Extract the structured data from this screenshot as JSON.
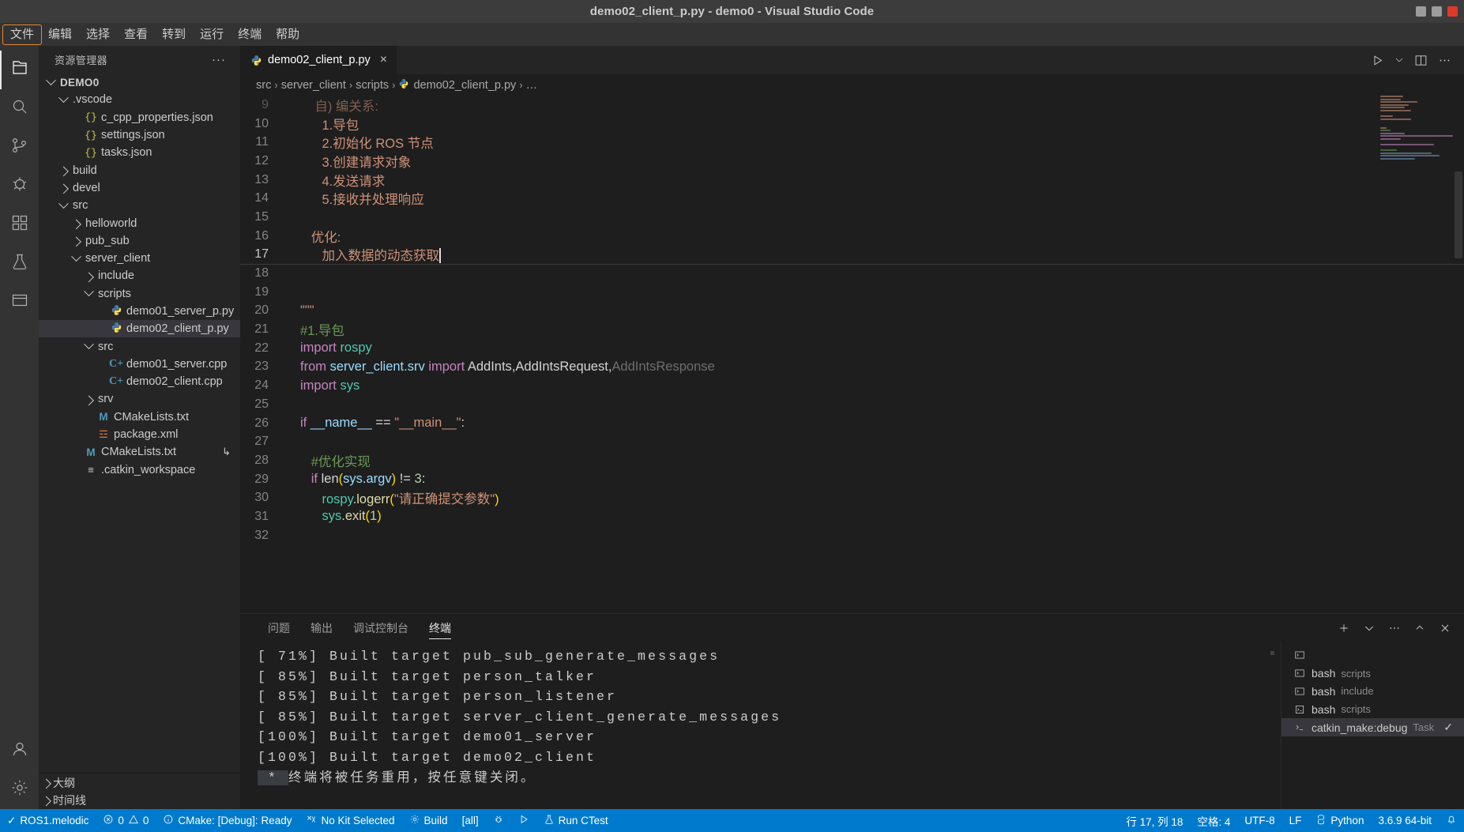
{
  "window": {
    "title": "demo02_client_p.py - demo0 - Visual Studio Code",
    "minimize": "minimize-button",
    "maximize": "maximize-button",
    "close": "close-button"
  },
  "menubar": {
    "items": [
      {
        "label": "文件",
        "focused": true
      },
      {
        "label": "编辑",
        "focused": false
      },
      {
        "label": "选择",
        "focused": false
      },
      {
        "label": "查看",
        "focused": false
      },
      {
        "label": "转到",
        "focused": false
      },
      {
        "label": "运行",
        "focused": false
      },
      {
        "label": "终端",
        "focused": false
      },
      {
        "label": "帮助",
        "focused": false
      }
    ]
  },
  "activitybar": {
    "items": [
      {
        "name": "explorer",
        "icon": "files-icon",
        "active": true
      },
      {
        "name": "search",
        "icon": "search-icon",
        "active": false
      },
      {
        "name": "source-control",
        "icon": "source-control-icon",
        "active": false
      },
      {
        "name": "run-and-debug",
        "icon": "debug-icon",
        "active": false
      },
      {
        "name": "extensions",
        "icon": "extensions-icon",
        "active": false
      },
      {
        "name": "testing",
        "icon": "beaker-icon",
        "active": false
      },
      {
        "name": "cmake",
        "icon": "cmake-icon",
        "active": false
      }
    ],
    "bottom": [
      {
        "name": "accounts",
        "icon": "account-icon"
      },
      {
        "name": "settings",
        "icon": "gear-icon"
      }
    ]
  },
  "sidebar": {
    "title": "资源管理器",
    "more_actions": "···",
    "tree": [
      {
        "label": "DEMO0",
        "indent": 0,
        "twisty": "down",
        "icon": "none",
        "bold": true,
        "selected": false
      },
      {
        "label": ".vscode",
        "indent": 1,
        "twisty": "down",
        "icon": "none",
        "bold": false,
        "selected": false
      },
      {
        "label": "c_cpp_properties.json",
        "indent": 2,
        "twisty": "none",
        "icon": "json",
        "bold": false,
        "selected": false
      },
      {
        "label": "settings.json",
        "indent": 2,
        "twisty": "none",
        "icon": "json",
        "bold": false,
        "selected": false
      },
      {
        "label": "tasks.json",
        "indent": 2,
        "twisty": "none",
        "icon": "json",
        "bold": false,
        "selected": false
      },
      {
        "label": "build",
        "indent": 1,
        "twisty": "right",
        "icon": "none",
        "bold": false,
        "selected": false
      },
      {
        "label": "devel",
        "indent": 1,
        "twisty": "right",
        "icon": "none",
        "bold": false,
        "selected": false
      },
      {
        "label": "src",
        "indent": 1,
        "twisty": "down",
        "icon": "none",
        "bold": false,
        "selected": false
      },
      {
        "label": "helloworld",
        "indent": 2,
        "twisty": "right",
        "icon": "none",
        "bold": false,
        "selected": false
      },
      {
        "label": "pub_sub",
        "indent": 2,
        "twisty": "right",
        "icon": "none",
        "bold": false,
        "selected": false
      },
      {
        "label": "server_client",
        "indent": 2,
        "twisty": "down",
        "icon": "none",
        "bold": false,
        "selected": false
      },
      {
        "label": "include",
        "indent": 3,
        "twisty": "right",
        "icon": "none",
        "bold": false,
        "selected": false
      },
      {
        "label": "scripts",
        "indent": 3,
        "twisty": "down",
        "icon": "none",
        "bold": false,
        "selected": false
      },
      {
        "label": "demo01_server_p.py",
        "indent": 4,
        "twisty": "none",
        "icon": "py",
        "bold": false,
        "selected": false
      },
      {
        "label": "demo02_client_p.py",
        "indent": 4,
        "twisty": "none",
        "icon": "py",
        "bold": false,
        "selected": true
      },
      {
        "label": "src",
        "indent": 3,
        "twisty": "down",
        "icon": "none",
        "bold": false,
        "selected": false
      },
      {
        "label": "demo01_server.cpp",
        "indent": 4,
        "twisty": "none",
        "icon": "cpp",
        "bold": false,
        "selected": false
      },
      {
        "label": "demo02_client.cpp",
        "indent": 4,
        "twisty": "none",
        "icon": "cpp",
        "bold": false,
        "selected": false
      },
      {
        "label": "srv",
        "indent": 3,
        "twisty": "right",
        "icon": "none",
        "bold": false,
        "selected": false
      },
      {
        "label": "CMakeLists.txt",
        "indent": 3,
        "twisty": "none",
        "icon": "m",
        "bold": false,
        "selected": false
      },
      {
        "label": "package.xml",
        "indent": 3,
        "twisty": "none",
        "icon": "xml",
        "bold": false,
        "selected": false
      },
      {
        "label": "CMakeLists.txt",
        "indent": 2,
        "twisty": "none",
        "icon": "m",
        "bold": false,
        "selected": false,
        "meta": "↳"
      },
      {
        "label": ".catkin_workspace",
        "indent": 2,
        "twisty": "none",
        "icon": "txt",
        "bold": false,
        "selected": false
      }
    ],
    "sections": [
      {
        "label": "大纲",
        "twisty": "right"
      },
      {
        "label": "时间线",
        "twisty": "right"
      }
    ]
  },
  "editor": {
    "tab": {
      "label": "demo02_client_p.py",
      "icon": "python-icon",
      "close": "×"
    },
    "actions": [
      "run-icon",
      "chevron-down-icon",
      "split-editor-icon",
      "more-actions-icon"
    ],
    "breadcrumbs": [
      "src",
      "server_client",
      "scripts",
      "demo02_client_p.py",
      "…"
    ],
    "lines": [
      {
        "num": 9,
        "partial": true,
        "tokens": [
          {
            "t": "    自) 编关系:",
            "c": "str"
          }
        ]
      },
      {
        "num": 10,
        "tokens": [
          {
            "t": "      1.导包",
            "c": "str"
          }
        ]
      },
      {
        "num": 11,
        "tokens": [
          {
            "t": "      2.初始化 ROS 节点",
            "c": "str"
          }
        ]
      },
      {
        "num": 12,
        "tokens": [
          {
            "t": "      3.创建请求对象",
            "c": "str"
          }
        ]
      },
      {
        "num": 13,
        "tokens": [
          {
            "t": "      4.发送请求",
            "c": "str"
          }
        ]
      },
      {
        "num": 14,
        "tokens": [
          {
            "t": "      5.接收并处理响应",
            "c": "str"
          }
        ]
      },
      {
        "num": 15,
        "tokens": []
      },
      {
        "num": 16,
        "tokens": [
          {
            "t": "   优化:",
            "c": "str"
          }
        ]
      },
      {
        "num": 17,
        "cursor": true,
        "active": true,
        "tokens": [
          {
            "t": "      加入数据的动态获取",
            "c": "str"
          }
        ]
      },
      {
        "num": 18,
        "tokens": []
      },
      {
        "num": 19,
        "tokens": []
      },
      {
        "num": 20,
        "tokens": [
          {
            "t": "\"\"\"",
            "c": "str"
          }
        ]
      },
      {
        "num": 21,
        "tokens": [
          {
            "t": "#1.导包",
            "c": "com"
          }
        ]
      },
      {
        "num": 22,
        "tokens": [
          {
            "t": "import",
            "c": "kw"
          },
          {
            "t": " ",
            "c": "plain"
          },
          {
            "t": "rospy",
            "c": "cls"
          }
        ]
      },
      {
        "num": 23,
        "tokens": [
          {
            "t": "from",
            "c": "kw"
          },
          {
            "t": " ",
            "c": "plain"
          },
          {
            "t": "server_client.srv",
            "c": "id"
          },
          {
            "t": " ",
            "c": "plain"
          },
          {
            "t": "import",
            "c": "kw"
          },
          {
            "t": " ",
            "c": "plain"
          },
          {
            "t": "AddInts",
            "c": "plain"
          },
          {
            "t": ",",
            "c": "plain"
          },
          {
            "t": "AddIntsRequest",
            "c": "plain"
          },
          {
            "t": ",",
            "c": "plain"
          },
          {
            "t": "AddIntsResponse",
            "c": "dim"
          }
        ]
      },
      {
        "num": 24,
        "tokens": [
          {
            "t": "import",
            "c": "kw"
          },
          {
            "t": " ",
            "c": "plain"
          },
          {
            "t": "sys",
            "c": "cls"
          }
        ]
      },
      {
        "num": 25,
        "tokens": []
      },
      {
        "num": 26,
        "tokens": [
          {
            "t": "if",
            "c": "kw"
          },
          {
            "t": " ",
            "c": "plain"
          },
          {
            "t": "__name__",
            "c": "id"
          },
          {
            "t": " ",
            "c": "plain"
          },
          {
            "t": "==",
            "c": "op"
          },
          {
            "t": " ",
            "c": "plain"
          },
          {
            "t": "\"__main__\"",
            "c": "str"
          },
          {
            "t": ":",
            "c": "plain"
          }
        ]
      },
      {
        "num": 27,
        "indent_guides": 1,
        "tokens": []
      },
      {
        "num": 28,
        "indent_guides": 1,
        "tokens": [
          {
            "t": "   #优化实现",
            "c": "com"
          }
        ]
      },
      {
        "num": 29,
        "indent_guides": 1,
        "tokens": [
          {
            "t": "   ",
            "c": "plain"
          },
          {
            "t": "if",
            "c": "kw"
          },
          {
            "t": " ",
            "c": "plain"
          },
          {
            "t": "len",
            "c": "plain"
          },
          {
            "t": "(",
            "c": "paren1"
          },
          {
            "t": "sys",
            "c": "id"
          },
          {
            "t": ".",
            "c": "plain"
          },
          {
            "t": "argv",
            "c": "id"
          },
          {
            "t": ")",
            "c": "paren1"
          },
          {
            "t": " ",
            "c": "plain"
          },
          {
            "t": "!=",
            "c": "op"
          },
          {
            "t": " ",
            "c": "plain"
          },
          {
            "t": "3",
            "c": "num"
          },
          {
            "t": ":",
            "c": "plain"
          }
        ]
      },
      {
        "num": 30,
        "indent_guides": 2,
        "tokens": [
          {
            "t": "      ",
            "c": "plain"
          },
          {
            "t": "rospy",
            "c": "cls"
          },
          {
            "t": ".",
            "c": "plain"
          },
          {
            "t": "logerr",
            "c": "fn"
          },
          {
            "t": "(",
            "c": "paren1"
          },
          {
            "t": "\"请正确提交参数\"",
            "c": "str"
          },
          {
            "t": ")",
            "c": "paren1"
          }
        ]
      },
      {
        "num": 31,
        "indent_guides": 2,
        "tokens": [
          {
            "t": "      ",
            "c": "plain"
          },
          {
            "t": "sys",
            "c": "cls"
          },
          {
            "t": ".",
            "c": "plain"
          },
          {
            "t": "exit",
            "c": "fn"
          },
          {
            "t": "(",
            "c": "paren1"
          },
          {
            "t": "1",
            "c": "num"
          },
          {
            "t": ")",
            "c": "paren1"
          }
        ]
      },
      {
        "num": 32,
        "tokens": []
      }
    ]
  },
  "panel": {
    "tabs": [
      {
        "label": "问题",
        "active": false
      },
      {
        "label": "输出",
        "active": false
      },
      {
        "label": "调试控制台",
        "active": false
      },
      {
        "label": "终端",
        "active": true
      }
    ],
    "actions": [
      "add-terminal-icon",
      "chevron-down-icon",
      "more-actions-icon",
      "maximize-panel-icon",
      "close-panel-icon"
    ],
    "terminal_lines": [
      "[ 71%] Built target pub_sub_generate_messages",
      "[ 85%] Built target person_talker",
      "[ 85%] Built target person_listener",
      "[ 85%] Built target server_client_generate_messages",
      "[100%] Built target demo01_server",
      "[100%] Built target demo02_client"
    ],
    "terminal_last_prefix": " * ",
    "terminal_last_text": "终端将被任务重用，按任意键关闭。",
    "terminal_list": [
      {
        "name": "",
        "desc": "",
        "icon": "terminal-split-icon",
        "active": false,
        "header": true
      },
      {
        "name": "bash",
        "desc": "scripts",
        "icon": "terminal-icon",
        "active": false
      },
      {
        "name": "bash",
        "desc": "include",
        "icon": "terminal-icon",
        "active": false
      },
      {
        "name": "bash",
        "desc": "scripts",
        "icon": "terminal-bash-icon",
        "active": false
      },
      {
        "name": "catkin_make:debug",
        "desc": "Task",
        "icon": "task-icon",
        "active": true,
        "check": "✓"
      }
    ]
  },
  "statusbar": {
    "left": [
      {
        "icon": "check-icon",
        "label": "ROS1.melodic"
      },
      {
        "icon": "error-icon",
        "label": "0",
        "icon2": "warning-icon",
        "label2": "0"
      },
      {
        "icon": "info-icon",
        "label": "CMake: [Debug]: Ready"
      },
      {
        "icon": "tools-icon",
        "label": "No Kit Selected"
      },
      {
        "icon": "gear-icon",
        "label": "Build"
      },
      {
        "icon": "none",
        "label": "[all]"
      },
      {
        "icon": "bug-icon",
        "label": ""
      },
      {
        "icon": "play-icon",
        "label": ""
      },
      {
        "icon": "flask-icon",
        "label": "Run CTest"
      }
    ],
    "right": [
      {
        "label": "行 17, 列 18"
      },
      {
        "label": "空格: 4"
      },
      {
        "label": "UTF-8"
      },
      {
        "label": "LF"
      },
      {
        "icon": "python-icon",
        "label": "Python"
      },
      {
        "label": "3.6.9 64-bit"
      },
      {
        "icon": "bell-icon",
        "label": ""
      }
    ]
  },
  "colors": {
    "accent": "#007acc",
    "titlebar": "#3c3c3c",
    "sidebar": "#252526",
    "editor": "#1e1e1e",
    "selection": "#37373d",
    "focus_outline": "#e08a3c"
  }
}
